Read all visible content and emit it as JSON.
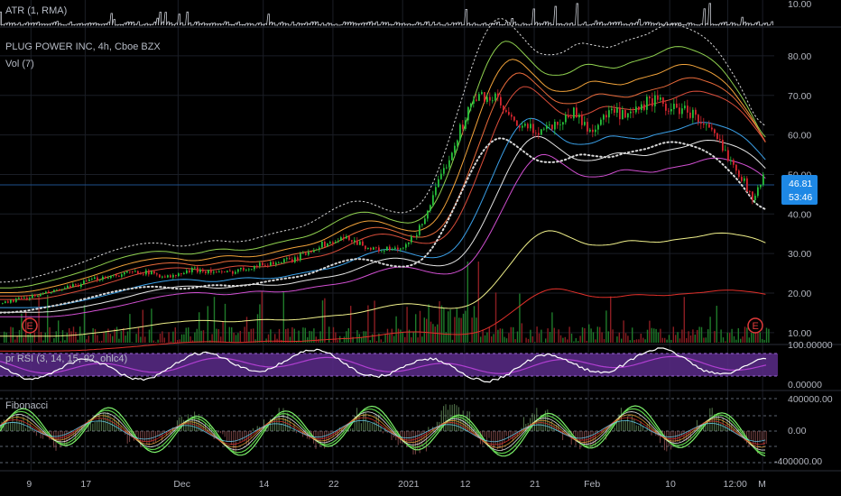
{
  "colors": {
    "background": "#000000",
    "grid": "#1b1e26",
    "candle_up": "#26c03a",
    "candle_down": "#d6262f",
    "rsi_band": "#5b2c8a",
    "rsi_line": "#ffffff",
    "rsi_signal": "#b03fd1",
    "fib_line": "#7cf06a",
    "price_badge": "#1e88e5"
  },
  "panels": {
    "atr": {
      "label": "ATR (1, RMA)",
      "tick": "10.00"
    },
    "price": {
      "label": "PLUG POWER INC, 4h, Cboe BZX",
      "vol_label": "Vol (7)"
    },
    "rsi": {
      "label": "pr RSI (3, 14, 15, 92, ohlc4)",
      "tick": "100.00000",
      "tick_low": "0.00000"
    },
    "fib": {
      "label": "Fibonacci",
      "ticks": [
        "400000.00",
        "0.00",
        "-400000.00"
      ]
    }
  },
  "price_badge": {
    "price": "46.81",
    "countdown": "53:46"
  },
  "earnings_markers": [
    "E",
    "E"
  ],
  "chart_data": {
    "type": "candlestick",
    "symbol": "PLUG POWER INC",
    "interval": "4h",
    "exchange": "Cboe BZX",
    "y_ticks": [
      "80.00",
      "70.00",
      "60.00",
      "50.00",
      "40.00",
      "30.00",
      "20.00",
      "10.00"
    ],
    "ylim": [
      7,
      85
    ],
    "x_ticks": [
      "9",
      "17",
      "Dec",
      "14",
      "22",
      "2021",
      "12",
      "21",
      "Feb",
      "10",
      "12:00",
      "M"
    ],
    "last_price": 46.81,
    "price_path": [
      {
        "t": 0,
        "p": 17.5
      },
      {
        "t": 0.05,
        "p": 19.5
      },
      {
        "t": 0.09,
        "p": 21.5
      },
      {
        "t": 0.13,
        "p": 24
      },
      {
        "t": 0.18,
        "p": 25.5
      },
      {
        "t": 0.22,
        "p": 24
      },
      {
        "t": 0.25,
        "p": 26
      },
      {
        "t": 0.29,
        "p": 25
      },
      {
        "t": 0.33,
        "p": 27
      },
      {
        "t": 0.38,
        "p": 28.5
      },
      {
        "t": 0.41,
        "p": 32
      },
      {
        "t": 0.45,
        "p": 34
      },
      {
        "t": 0.48,
        "p": 31
      },
      {
        "t": 0.52,
        "p": 31
      },
      {
        "t": 0.54,
        "p": 36
      },
      {
        "t": 0.56,
        "p": 45
      },
      {
        "t": 0.58,
        "p": 55
      },
      {
        "t": 0.605,
        "p": 67
      },
      {
        "t": 0.62,
        "p": 70
      },
      {
        "t": 0.64,
        "p": 69
      },
      {
        "t": 0.66,
        "p": 63
      },
      {
        "t": 0.69,
        "p": 61
      },
      {
        "t": 0.72,
        "p": 63
      },
      {
        "t": 0.74,
        "p": 66
      },
      {
        "t": 0.76,
        "p": 61
      },
      {
        "t": 0.79,
        "p": 66
      },
      {
        "t": 0.81,
        "p": 64
      },
      {
        "t": 0.84,
        "p": 69
      },
      {
        "t": 0.86,
        "p": 67
      },
      {
        "t": 0.89,
        "p": 66
      },
      {
        "t": 0.92,
        "p": 60
      },
      {
        "t": 0.95,
        "p": 52
      },
      {
        "t": 0.97,
        "p": 44
      },
      {
        "t": 0.985,
        "p": 49
      },
      {
        "t": 1.0,
        "p": 46.81
      }
    ]
  }
}
